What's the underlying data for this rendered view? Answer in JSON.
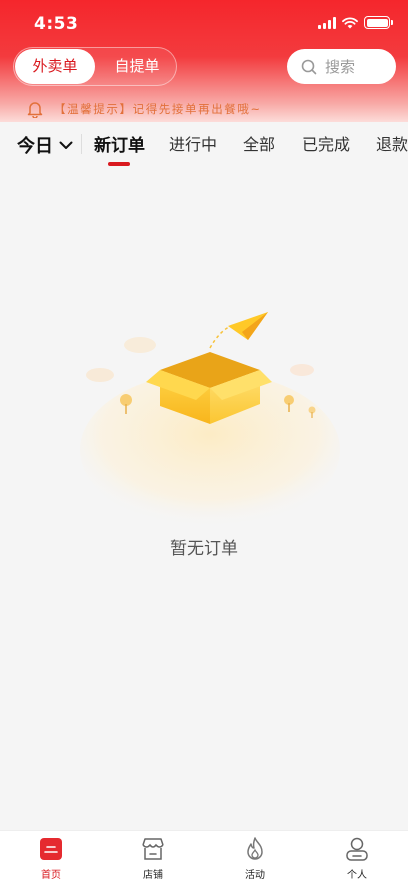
{
  "status_bar": {
    "time": "4:53"
  },
  "header": {
    "segment": {
      "active": "外卖单",
      "inactive": "自提单"
    },
    "search": {
      "placeholder": "搜索"
    }
  },
  "notice": {
    "text": "【温馨提示】记得先接单再出餐哦~"
  },
  "filter": {
    "day": "今日",
    "tabs": [
      {
        "label": "新订单",
        "active": true
      },
      {
        "label": "进行中"
      },
      {
        "label": "全部"
      },
      {
        "label": "已完成"
      },
      {
        "label": "退款"
      }
    ]
  },
  "empty_state": {
    "text": "暂无订单"
  },
  "bottom_nav": {
    "items": [
      {
        "label": "首页",
        "icon": "home-icon",
        "active": true
      },
      {
        "label": "店铺",
        "icon": "store-icon"
      },
      {
        "label": "活动",
        "icon": "flame-icon"
      },
      {
        "label": "个人",
        "icon": "person-icon"
      }
    ]
  },
  "colors": {
    "brand": "#d9191f",
    "header_red": "#f5262c",
    "notice_orange": "#e2703a",
    "background": "#f5f5f5"
  }
}
